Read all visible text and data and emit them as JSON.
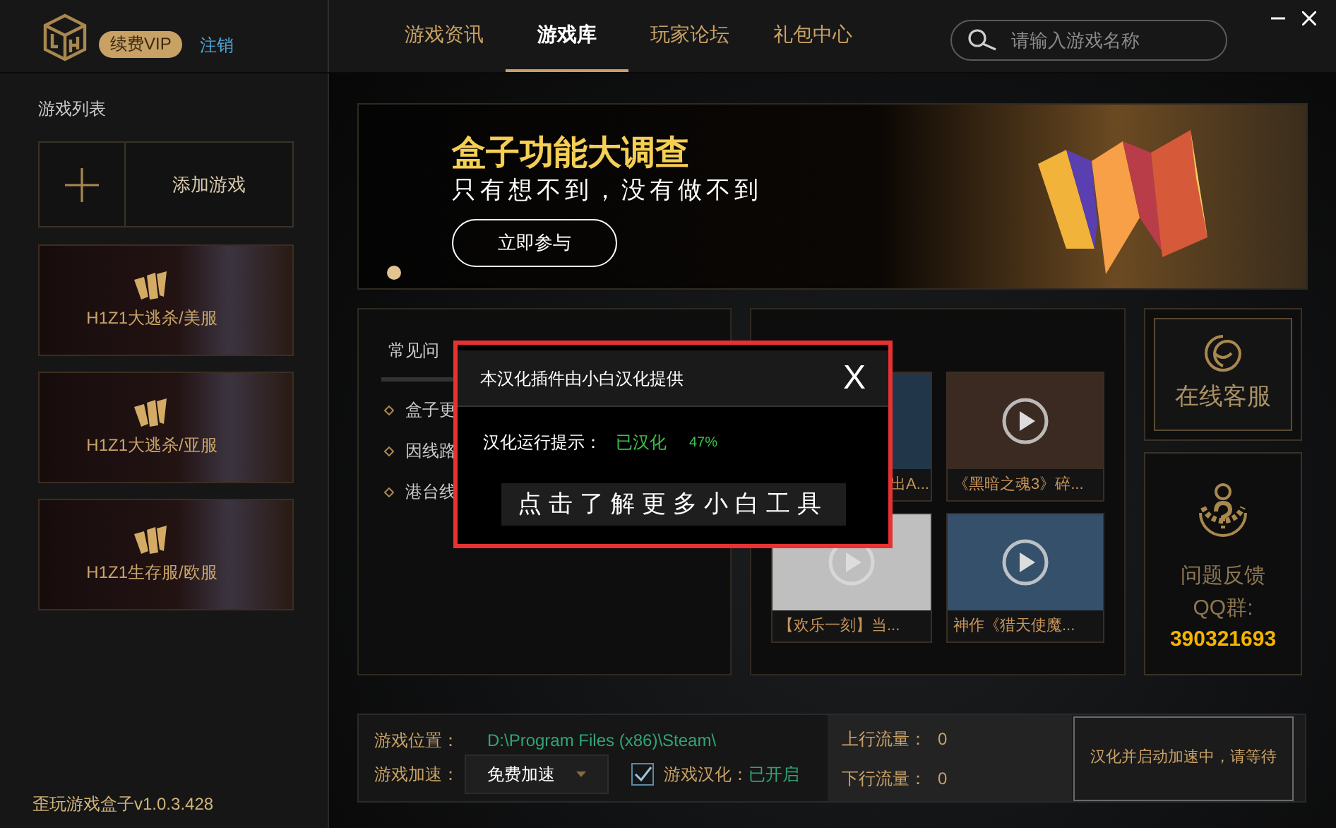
{
  "header": {
    "vip_button": "续费VIP",
    "logout_link": "注销",
    "tabs": [
      {
        "label": "游戏资讯",
        "selected": false
      },
      {
        "label": "游戏库",
        "selected": true
      },
      {
        "label": "玩家论坛",
        "selected": false
      },
      {
        "label": "礼包中心",
        "selected": false
      }
    ],
    "search": {
      "placeholder": "请输入游戏名称"
    }
  },
  "sidebar": {
    "title": "游戏列表",
    "add_game": "添加游戏",
    "games": [
      {
        "name": "H1Z1大逃杀/美服"
      },
      {
        "name": "H1Z1大逃杀/亚服"
      },
      {
        "name": "H1Z1生存服/欧服"
      }
    ],
    "version": "歪玩游戏盒子v1.0.3.428"
  },
  "banner": {
    "title": "盒子功能大调查",
    "subtitle": "只有想不到，没有做不到",
    "button": "立即参与"
  },
  "faq": {
    "title": "常见问",
    "items": [
      "盒子更",
      "因线路",
      "港台线"
    ]
  },
  "videos": [
    {
      "caption": "出A..."
    },
    {
      "caption": "《黑暗之魂3》碎..."
    },
    {
      "caption": "【欢乐一刻】当..."
    },
    {
      "caption": "神作《猎天使魔..."
    }
  ],
  "service": {
    "label": "在线客服"
  },
  "feedback": {
    "label": "问题反馈",
    "qq_label": "QQ群:",
    "qq_number": "390321693"
  },
  "bottom": {
    "location_label": "游戏位置：",
    "location": "D:\\Program Files (x86)\\Steam\\",
    "speed_label": "游戏加速：",
    "speed_value": "免费加速",
    "localize_checked": true,
    "localize_label": "游戏汉化：",
    "localize_state": "已开启",
    "upload_label": "上行流量：",
    "upload": "0",
    "download_label": "下行流量：",
    "download": "0",
    "status_button": "汉化并启动加速中，请等待"
  },
  "popup": {
    "title": "本汉化插件由小白汉化提供",
    "close": "X",
    "hint_label": "汉化运行提示：",
    "hint_state": "已汉化",
    "progress": "47%",
    "link_button": "点击了解更多小白工具"
  }
}
